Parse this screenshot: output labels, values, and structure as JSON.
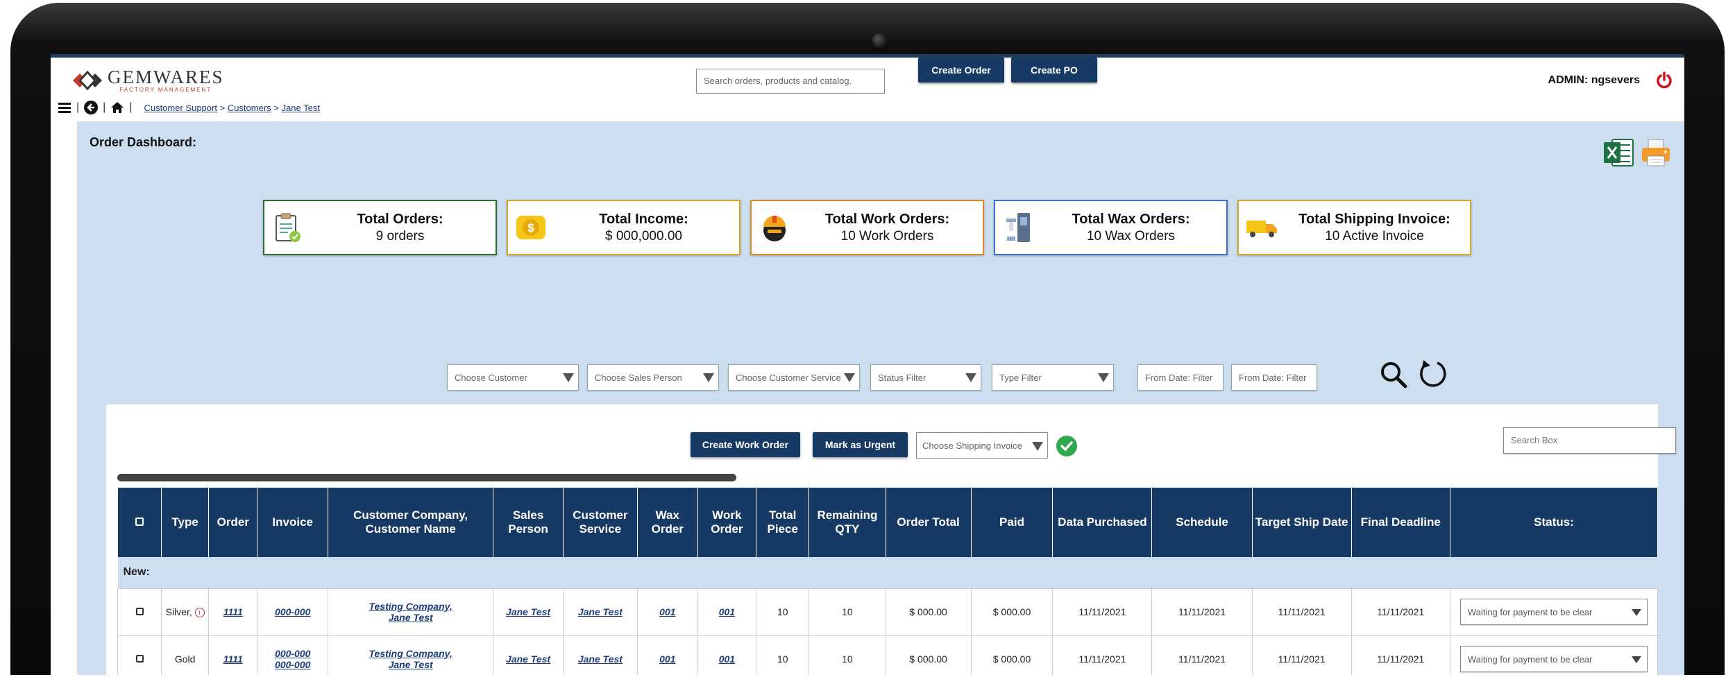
{
  "app": {
    "logo_name": "GEMWARES",
    "logo_sub": "FACTORY MANAGEMENT",
    "search_placeholder": "Search orders, products and catalog.",
    "create_order": "Create Order",
    "create_po": "Create PO",
    "admin_label": "ADMIN: ngsevers"
  },
  "breadcrumb": {
    "items": [
      "Customer Support",
      "Customers",
      "Jane Test"
    ],
    "separators": [
      ">",
      ">"
    ]
  },
  "dashboard": {
    "title": "Order Dashboard:",
    "cards": [
      {
        "title": "Total Orders:",
        "value": "9 orders",
        "border": "#2e6b2e",
        "icon": "clipboard-icon"
      },
      {
        "title": "Total Income:",
        "value": "$ 000,000.00",
        "border": "#d4a72c",
        "icon": "money-icon"
      },
      {
        "title": "Total Work Orders:",
        "value": "10 Work Orders",
        "border": "#e08a2a",
        "icon": "worker-icon"
      },
      {
        "title": "Total Wax Orders:",
        "value": "10 Wax Orders",
        "border": "#3b6fc9",
        "icon": "wax-machine-icon"
      },
      {
        "title": "Total Shipping Invoice:",
        "value": "10 Active Invoice",
        "border": "#d4a72c",
        "icon": "truck-icon"
      }
    ],
    "filters": [
      "Choose Customer",
      "Choose Sales Person",
      "Choose Customer Service",
      "Status Filter",
      "Type Filter",
      "From Date: Filter",
      "From Date: Filter"
    ]
  },
  "table_panel": {
    "create_work_order": "Create Work Order",
    "mark_urgent": "Mark as Urgent",
    "shipping_placeholder": "Choose Shipping Invoice",
    "search_placeholder": "Search Box",
    "headers": [
      "Type",
      "Order",
      "Invoice",
      "Customer Company, Customer Name",
      "Sales Person",
      "Customer Service",
      "Wax Order",
      "Work Order",
      "Total Piece",
      "Remaining QTY",
      "Order Total",
      "Paid",
      "Data Purchased",
      "Schedule",
      "Target Ship Date",
      "Final Deadline",
      "Status:"
    ],
    "section_label": "New:",
    "rows": [
      {
        "type": "Silver,",
        "order": "1111",
        "invoice": "000-000",
        "invoice2": "",
        "company": "Testing Company,",
        "customer": "Jane Test",
        "sales": "Jane Test",
        "service": "Jane Test",
        "wax": "001",
        "work": "001",
        "piece": "10",
        "remaining": "10",
        "total": "$ 000.00",
        "paid": "$ 000.00",
        "purchased": "11/11/2021",
        "schedule": "11/11/2021",
        "ship": "11/11/2021",
        "deadline": "11/11/2021",
        "status": "Waiting for payment to be clear"
      },
      {
        "type": "Gold",
        "order": "1111",
        "invoice": "000-000",
        "invoice2": "000-000",
        "company": "Testing Company,",
        "customer": "Jane Test",
        "sales": "Jane Test",
        "service": "Jane Test",
        "wax": "001",
        "work": "001",
        "piece": "10",
        "remaining": "10",
        "total": "$ 000.00",
        "paid": "$ 000.00",
        "purchased": "11/11/2021",
        "schedule": "11/11/2021",
        "ship": "11/11/2021",
        "deadline": "11/11/2021",
        "status": "Waiting for payment to be clear"
      }
    ]
  }
}
